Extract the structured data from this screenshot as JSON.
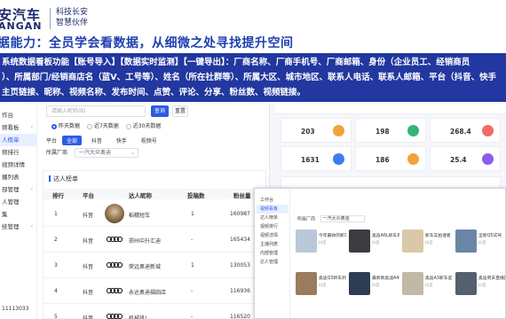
{
  "header": {
    "logo_cn": "安汽车",
    "logo_en": "ANGAN",
    "slogan_line1": "科技长安",
    "slogan_line2": "智慧伙伴",
    "title": "据能力：全员学会看数据，从细微之处寻找提升空间"
  },
  "banner": {
    "line1": "系统数据看板功能【账号导入】【数据实时监测】【一键导出】：厂商名称、厂商手机号、厂商邮箱、身份（企业员工、经销商员",
    "line2": "）、所属部门/经销商店名（蓝V、工号等）、姓名（所在社群等）、所属大区、城市地区、联系人电话、联系人邮箱、平台（抖音、快手",
    "line3": "主页链接、昵称、视频名称、发布时间、点赞、评论、分享、粉丝数、视频链接。"
  },
  "left_app": {
    "sidebar": {
      "items": [
        {
          "label": "作台",
          "active": false,
          "chevron": false
        },
        {
          "label": "频看板",
          "active": false,
          "chevron": true
        },
        {
          "label": "人榜单",
          "active": true,
          "chevron": false
        },
        {
          "label": "频排行",
          "active": false,
          "chevron": false
        },
        {
          "label": "视频详情",
          "active": false,
          "chevron": false
        },
        {
          "label": "播列表",
          "active": false,
          "chevron": false
        },
        {
          "label": "部管理",
          "active": false,
          "chevron": true
        },
        {
          "label": "人管理",
          "active": false,
          "chevron": false
        },
        {
          "label": "集",
          "active": false,
          "chevron": false
        },
        {
          "label": "统管理",
          "active": false,
          "chevron": true
        }
      ],
      "footer": "11113033"
    },
    "filter": {
      "search_placeholder": "请输入昵称/ID",
      "query_label": "查询",
      "reset_label": "重置",
      "radio_label_a": "昨天数据",
      "radio_label_b": "近7天数据",
      "radio_label_c": "近30天数据",
      "radio_selected": "昨天数据",
      "platform_label": "平台",
      "platform_options": [
        "全部",
        "抖音",
        "快手",
        "视频号"
      ],
      "platform_selected": "全部",
      "dept_label": "所属厂商",
      "dept_value": "一汽大众奥迪"
    },
    "ranking": {
      "title": "达人榜单",
      "columns": [
        "排行",
        "平台",
        "达人昵称",
        "投稿数",
        "粉丝量"
      ],
      "rows": [
        {
          "rank": "1",
          "platform": "抖音",
          "name": "稻穗短车",
          "posts": "1",
          "fans": "160987"
        },
        {
          "rank": "2",
          "platform": "抖音",
          "name": "郑州中升汇迪",
          "posts": "-",
          "fans": "165434"
        },
        {
          "rank": "3",
          "platform": "抖音",
          "name": "荣远奥迪新城",
          "posts": "1",
          "fans": "130053"
        },
        {
          "rank": "4",
          "platform": "抖音",
          "name": "永达奥迪福田店",
          "posts": "-",
          "fans": "116936"
        },
        {
          "rank": "5",
          "platform": "抖音",
          "name": "机械班!",
          "posts": "-",
          "fans": "116520"
        }
      ]
    }
  },
  "right_app": {
    "stats": [
      {
        "value": "203",
        "color": "#f1a43a"
      },
      {
        "value": "198",
        "color": "#34b37b"
      },
      {
        "value": "268.4",
        "color": "#f26b6b"
      },
      {
        "value": "1631",
        "color": "#3d7cf0"
      },
      {
        "value": "186",
        "color": "#f1a43a"
      },
      {
        "value": "25.4",
        "color": "#8a5cf0"
      }
    ]
  },
  "overlay_app": {
    "sidebar": [
      "工作台",
      "视频看板",
      "达人榜单",
      "视频排行",
      "视频详情",
      "主播列表",
      "内部管理",
      "达人管理"
    ],
    "sidebar_active": "视频看板",
    "dept_label": "所属厂商",
    "dept_value": "一汽大众奥迪",
    "videos": [
      {
        "title": "今年最帅的新车",
        "meta": "抖音"
      },
      {
        "title": "奥迪A6L新车到店",
        "meta": "抖音"
      },
      {
        "title": "新车实拍速看",
        "meta": "抖音"
      },
      {
        "title": "全新Q5试驾",
        "meta": "抖音"
      },
      {
        "title": "奥迪Q3新车到店实拍",
        "meta": "抖音"
      },
      {
        "title": "最新款奥迪A4L来啦",
        "meta": "抖音"
      },
      {
        "title": "奥迪A3新车鉴赏",
        "meta": "抖音"
      },
      {
        "title": "奥迪周末直播回放",
        "meta": "抖音"
      }
    ]
  },
  "colors": {
    "brand_blue": "#22379f",
    "accent": "#2c5ce6"
  }
}
